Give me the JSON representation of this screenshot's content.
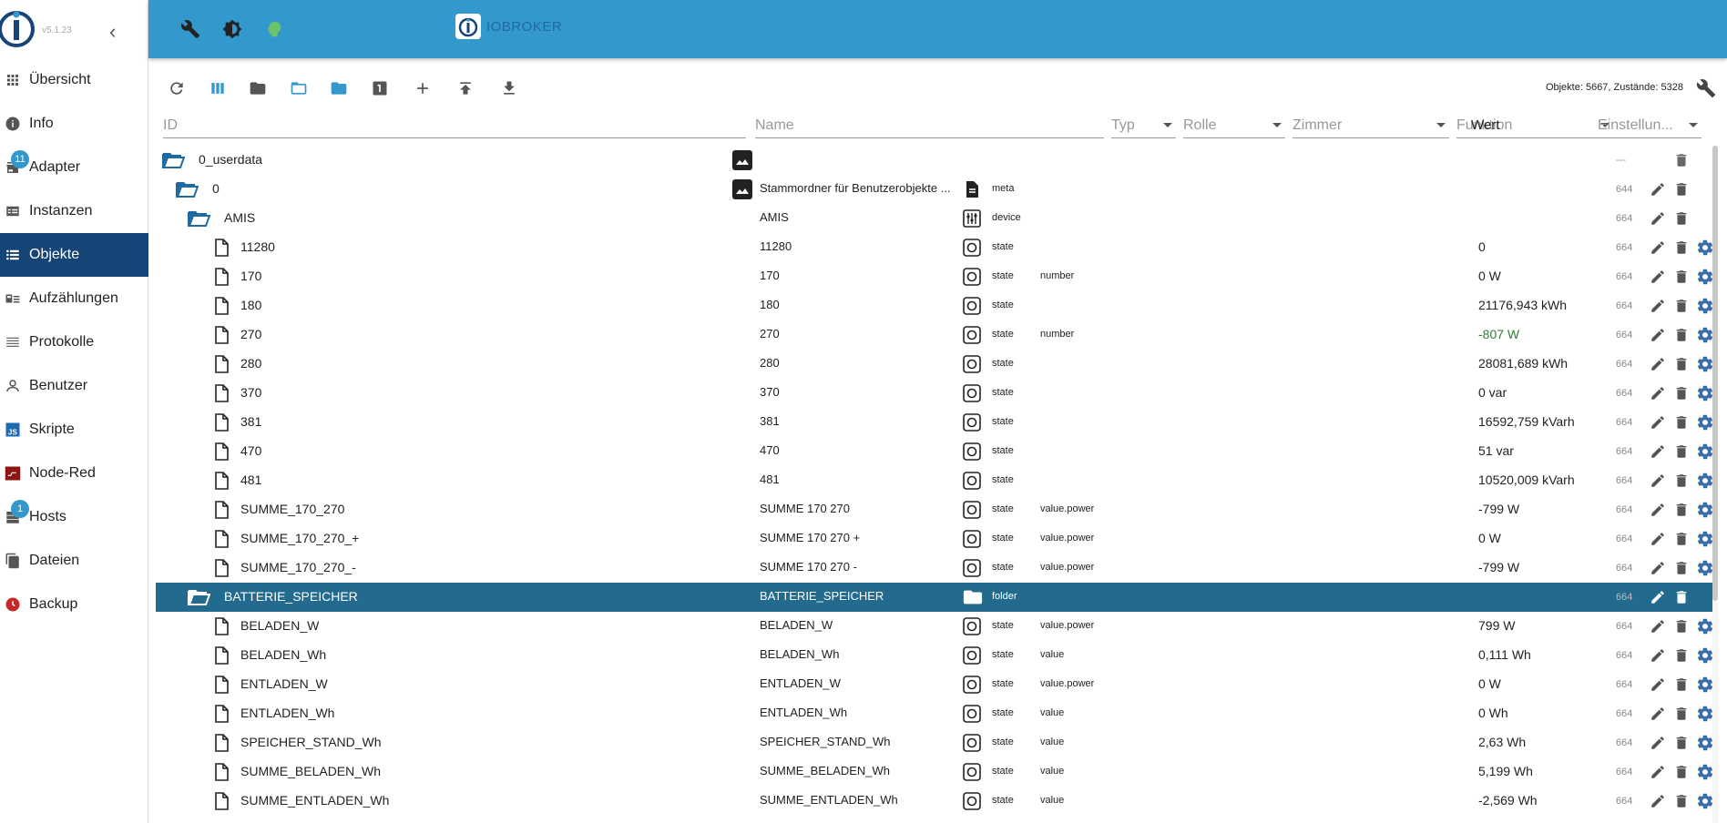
{
  "app": {
    "version": "v5.1.23",
    "brand": "IOBROKER"
  },
  "sidebar": {
    "items": [
      {
        "label": "Übersicht",
        "icon": "apps-grid-icon"
      },
      {
        "label": "Info",
        "icon": "info-icon"
      },
      {
        "label": "Adapter",
        "icon": "store-icon",
        "badge": "11"
      },
      {
        "label": "Instanzen",
        "icon": "instances-icon"
      },
      {
        "label": "Objekte",
        "icon": "list-icon",
        "active": true
      },
      {
        "label": "Aufzählungen",
        "icon": "enums-icon"
      },
      {
        "label": "Protokolle",
        "icon": "log-lines-icon"
      },
      {
        "label": "Benutzer",
        "icon": "user-icon"
      },
      {
        "label": "Skripte",
        "icon": "javascript-icon"
      },
      {
        "label": "Node-Red",
        "icon": "node-red-icon"
      },
      {
        "label": "Hosts",
        "icon": "server-icon",
        "badge": "1"
      },
      {
        "label": "Dateien",
        "icon": "files-icon"
      },
      {
        "label": "Backup",
        "icon": "backup-icon"
      }
    ]
  },
  "toolbar": {
    "counts": "Objekte: 5667, Zustände: 5328",
    "tool_icons": [
      "refresh-icon",
      "columns-icon",
      "folder-icon",
      "folder-open-icon",
      "folder-blue-icon",
      "one-icon",
      "plus-icon",
      "upload-icon",
      "download-icon"
    ]
  },
  "filters": {
    "id": "ID",
    "name": "Name",
    "type": "Typ",
    "role": "Rolle",
    "room": "Zimmer",
    "function": "Funktion",
    "value": "Wert",
    "settings": "Einstellun..."
  },
  "rows": [
    {
      "indent": 0,
      "kind": "folder-open",
      "id": "0_userdata",
      "name": "",
      "type": "",
      "role": "",
      "value": "",
      "acl": "---",
      "image": true,
      "acts": "del"
    },
    {
      "indent": 1,
      "kind": "folder-open",
      "id": "0",
      "name": "Stammordner für Benutzerobjekte ...",
      "type": "meta",
      "role": "",
      "value": "",
      "acl": "644",
      "image": true,
      "ticon": "meta",
      "acts": "ed"
    },
    {
      "indent": 2,
      "kind": "folder-open",
      "id": "AMIS",
      "name": "AMIS",
      "type": "device",
      "role": "",
      "value": "",
      "acl": "664",
      "ticon": "device",
      "acts": "ed"
    },
    {
      "indent": 3,
      "kind": "file",
      "id": "11280",
      "name": "11280",
      "type": "state",
      "role": "",
      "value": "0",
      "acl": "664",
      "ticon": "state",
      "acts": "eds"
    },
    {
      "indent": 3,
      "kind": "file",
      "id": "170",
      "name": "170",
      "type": "state",
      "role": "number",
      "value": "0 W",
      "acl": "664",
      "ticon": "state",
      "acts": "eds"
    },
    {
      "indent": 3,
      "kind": "file",
      "id": "180",
      "name": "180",
      "type": "state",
      "role": "",
      "value": "21176,943 kWh",
      "acl": "664",
      "ticon": "state",
      "acts": "eds"
    },
    {
      "indent": 3,
      "kind": "file",
      "id": "270",
      "name": "270",
      "type": "state",
      "role": "number",
      "value": "-807 W",
      "valcolor": "#2e7d32",
      "acl": "664",
      "ticon": "state",
      "acts": "eds"
    },
    {
      "indent": 3,
      "kind": "file",
      "id": "280",
      "name": "280",
      "type": "state",
      "role": "",
      "value": "28081,689 kWh",
      "acl": "664",
      "ticon": "state",
      "acts": "eds"
    },
    {
      "indent": 3,
      "kind": "file",
      "id": "370",
      "name": "370",
      "type": "state",
      "role": "",
      "value": "0 var",
      "acl": "664",
      "ticon": "state",
      "acts": "eds"
    },
    {
      "indent": 3,
      "kind": "file",
      "id": "381",
      "name": "381",
      "type": "state",
      "role": "",
      "value": "16592,759 kVarh",
      "acl": "664",
      "ticon": "state",
      "acts": "eds"
    },
    {
      "indent": 3,
      "kind": "file",
      "id": "470",
      "name": "470",
      "type": "state",
      "role": "",
      "value": "51 var",
      "acl": "664",
      "ticon": "state",
      "acts": "eds"
    },
    {
      "indent": 3,
      "kind": "file",
      "id": "481",
      "name": "481",
      "type": "state",
      "role": "",
      "value": "10520,009 kVarh",
      "acl": "664",
      "ticon": "state",
      "acts": "eds"
    },
    {
      "indent": 3,
      "kind": "file",
      "id": "SUMME_170_270",
      "name": "SUMME 170 270",
      "type": "state",
      "role": "value.power",
      "value": "-799 W",
      "acl": "664",
      "ticon": "state",
      "acts": "eds"
    },
    {
      "indent": 3,
      "kind": "file",
      "id": "SUMME_170_270_+",
      "name": "SUMME 170 270 +",
      "type": "state",
      "role": "value.power",
      "value": "0 W",
      "acl": "664",
      "ticon": "state",
      "acts": "eds"
    },
    {
      "indent": 3,
      "kind": "file",
      "id": "SUMME_170_270_-",
      "name": "SUMME 170 270 -",
      "type": "state",
      "role": "value.power",
      "value": "-799 W",
      "acl": "664",
      "ticon": "state",
      "acts": "eds"
    },
    {
      "indent": 2,
      "kind": "folder-open",
      "id": "BATTERIE_SPEICHER",
      "name": "BATTERIE_SPEICHER",
      "type": "folder",
      "role": "",
      "value": "",
      "acl": "664",
      "ticon": "folder",
      "acts": "ed",
      "selected": true
    },
    {
      "indent": 3,
      "kind": "file",
      "id": "BELADEN_W",
      "name": "BELADEN_W",
      "type": "state",
      "role": "value.power",
      "value": "799 W",
      "acl": "664",
      "ticon": "state",
      "acts": "eds"
    },
    {
      "indent": 3,
      "kind": "file",
      "id": "BELADEN_Wh",
      "name": "BELADEN_Wh",
      "type": "state",
      "role": "value",
      "value": "0,111 Wh",
      "acl": "664",
      "ticon": "state",
      "acts": "eds"
    },
    {
      "indent": 3,
      "kind": "file",
      "id": "ENTLADEN_W",
      "name": "ENTLADEN_W",
      "type": "state",
      "role": "value.power",
      "value": "0 W",
      "acl": "664",
      "ticon": "state",
      "acts": "eds"
    },
    {
      "indent": 3,
      "kind": "file",
      "id": "ENTLADEN_Wh",
      "name": "ENTLADEN_Wh",
      "type": "state",
      "role": "value",
      "value": "0 Wh",
      "acl": "664",
      "ticon": "state",
      "acts": "eds"
    },
    {
      "indent": 3,
      "kind": "file",
      "id": "SPEICHER_STAND_Wh",
      "name": "SPEICHER_STAND_Wh",
      "type": "state",
      "role": "value",
      "value": "2,63 Wh",
      "acl": "664",
      "ticon": "state",
      "acts": "eds"
    },
    {
      "indent": 3,
      "kind": "file",
      "id": "SUMME_BELADEN_Wh",
      "name": "SUMME_BELADEN_Wh",
      "type": "state",
      "role": "value",
      "value": "5,199 Wh",
      "acl": "664",
      "ticon": "state",
      "acts": "eds"
    },
    {
      "indent": 3,
      "kind": "file",
      "id": "SUMME_ENTLADEN_Wh",
      "name": "SUMME_ENTLADEN_Wh",
      "type": "state",
      "role": "value",
      "value": "-2,569 Wh",
      "acl": "664",
      "ticon": "state",
      "acts": "eds"
    }
  ],
  "colors": {
    "accent": "#3399cc",
    "active_nav": "#164477",
    "selected_row": "#236b8e",
    "folder": "#1f6aa0",
    "setting_gear": "#3a6ea5"
  }
}
